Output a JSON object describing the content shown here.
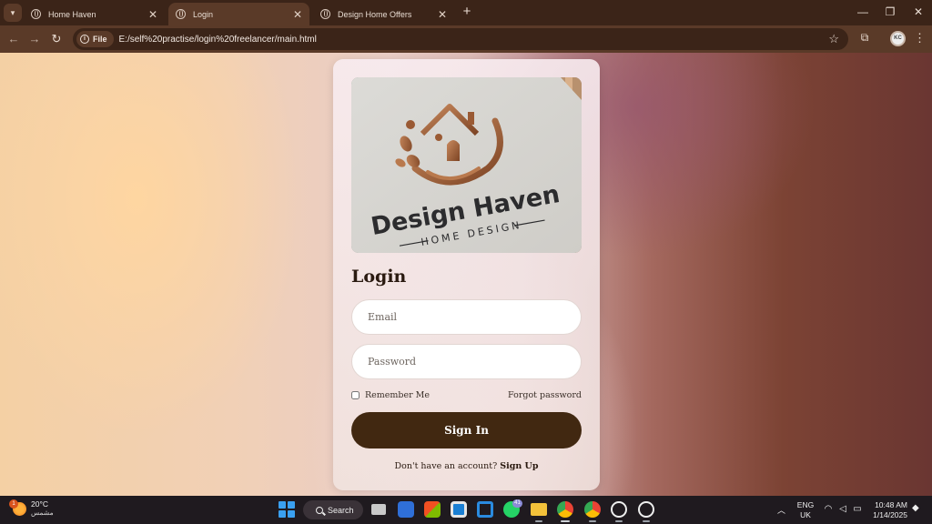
{
  "browser": {
    "tabs": [
      {
        "label": "Home Haven",
        "active": false
      },
      {
        "label": "Login",
        "active": true
      },
      {
        "label": "Design Home Offers",
        "active": false
      }
    ],
    "url_chip": "File",
    "url": "E:/self%20practise/login%20freelancer/main.html",
    "profile_initials": "KC"
  },
  "logo": {
    "brand": "Design Haven",
    "tagline": "HOME DESIGN"
  },
  "login": {
    "title": "Login",
    "email_placeholder": "Email",
    "password_placeholder": "Password",
    "remember_label": "Remember Me",
    "forgot_label": "Forgot password",
    "signin_label": "Sign In",
    "signup_prompt": "Don't have an account?",
    "signup_link": "Sign Up"
  },
  "taskbar": {
    "weather_temp": "20°C",
    "weather_desc": "مشمس",
    "weather_badge": "1",
    "search_label": "Search",
    "whatsapp_badge": "41",
    "lang_line1": "ENG",
    "lang_line2": "UK",
    "time": "10:48 AM",
    "date": "1/14/2025"
  },
  "colors": {
    "button_brown": "#412811",
    "chrome_brown": "#5a3a28",
    "logo_bronze": "#9a5a34"
  }
}
